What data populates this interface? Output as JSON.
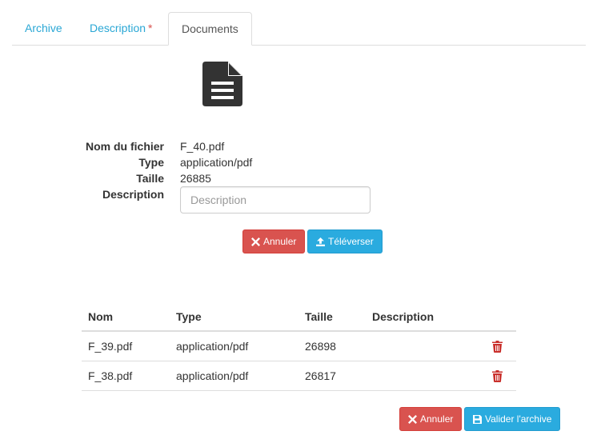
{
  "tabs": [
    {
      "label": "Archive",
      "active": false
    },
    {
      "label": "Description",
      "required": "*",
      "active": false
    },
    {
      "label": "Documents",
      "active": true
    }
  ],
  "file_icon": "file-text-icon",
  "file": {
    "name_label": "Nom du fichier",
    "name": "F_40.pdf",
    "type_label": "Type",
    "type": "application/pdf",
    "size_label": "Taille",
    "size": "26885",
    "description_label": "Description",
    "description_placeholder": "Description",
    "description_value": ""
  },
  "upload_actions": {
    "cancel_label": "Annuler",
    "upload_label": "Téléverser"
  },
  "table": {
    "headers": [
      "Nom",
      "Type",
      "Taille",
      "Description",
      ""
    ],
    "rows": [
      {
        "name": "F_39.pdf",
        "type": "application/pdf",
        "size": "26898",
        "description": ""
      },
      {
        "name": "F_38.pdf",
        "type": "application/pdf",
        "size": "26817",
        "description": ""
      }
    ]
  },
  "footer_actions": {
    "cancel_label": "Annuler",
    "validate_label": "Valider l'archive"
  },
  "colors": {
    "link": "#2aa7d5",
    "danger": "#d9534f",
    "info": "#2aabdf",
    "icon": "#333333"
  }
}
